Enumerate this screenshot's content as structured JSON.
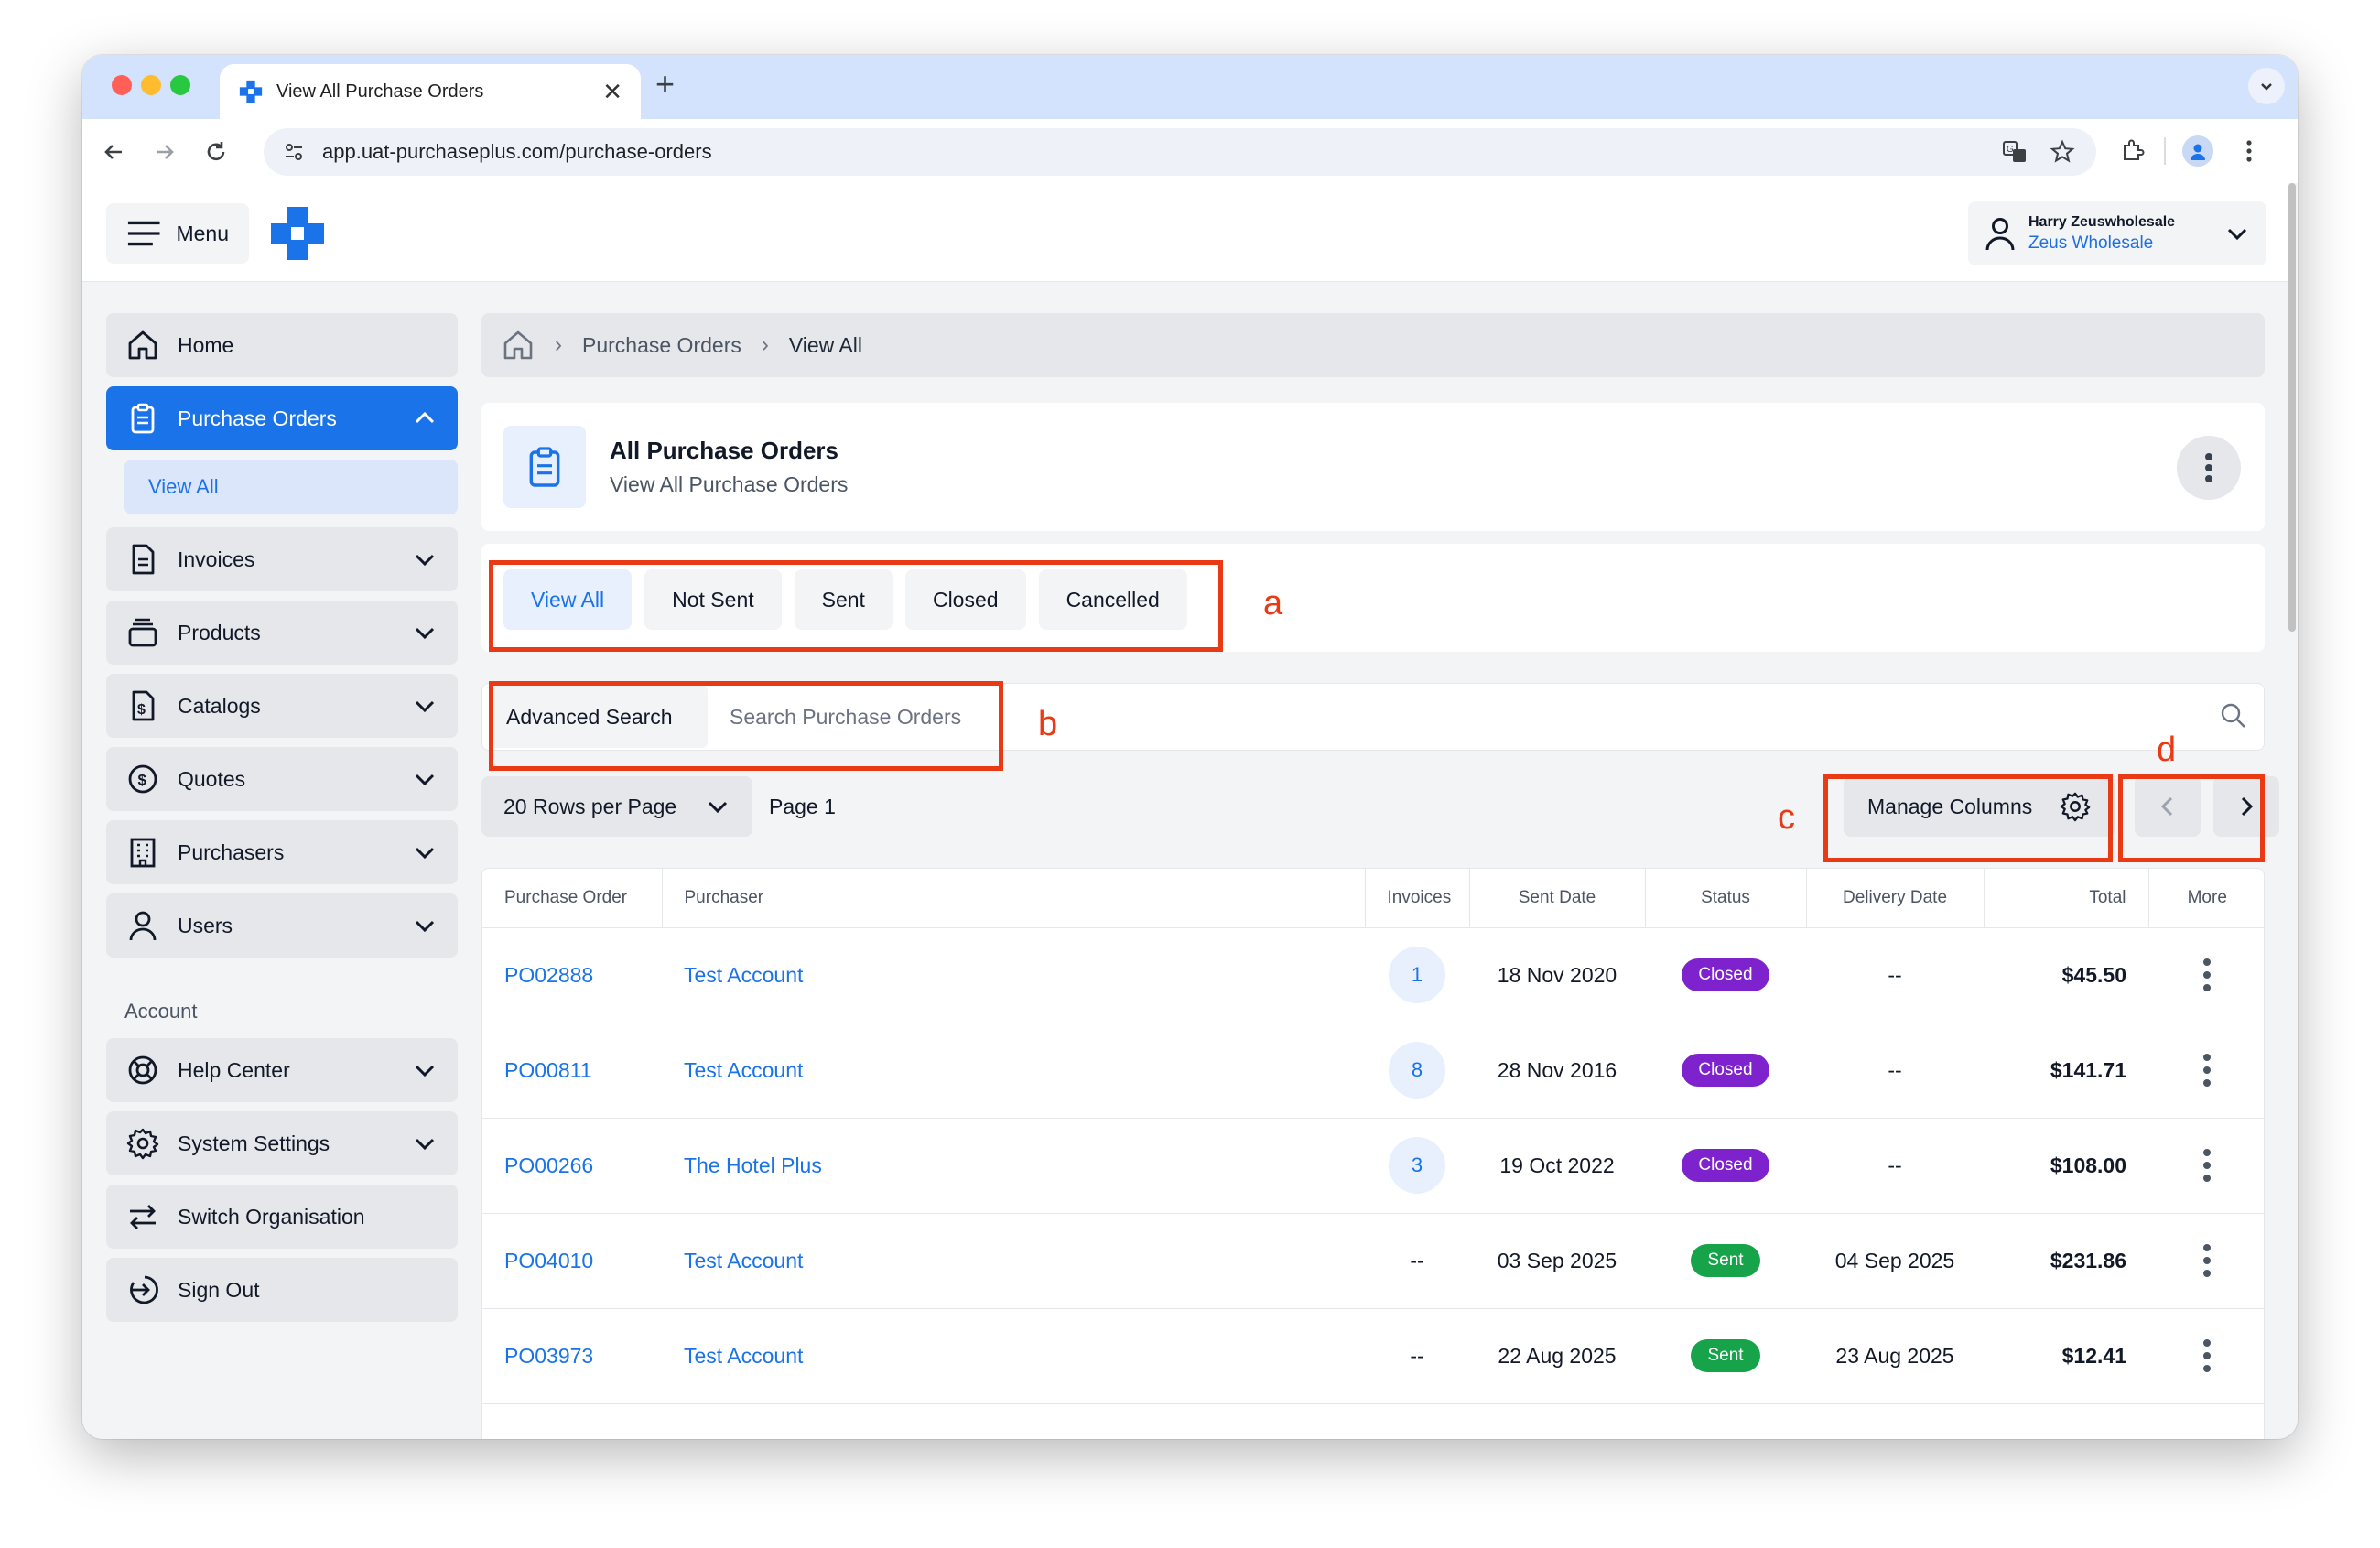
{
  "browser": {
    "tab_title": "View All Purchase Orders",
    "tab_close": "✕",
    "new_tab": "+",
    "url": "app.uat-purchaseplus.com/purchase-orders"
  },
  "topbar": {
    "menu_label": "Menu",
    "user_name": "Harry Zeuswholesale",
    "organisation": "Zeus Wholesale"
  },
  "sidebar": {
    "items": [
      {
        "label": "Home",
        "icon": "home-icon"
      },
      {
        "label": "Purchase Orders",
        "icon": "clipboard-icon",
        "active": true
      },
      {
        "label": "Invoices",
        "icon": "document-icon"
      },
      {
        "label": "Products",
        "icon": "box-stack-icon"
      },
      {
        "label": "Catalogs",
        "icon": "dollar-document-icon"
      },
      {
        "label": "Quotes",
        "icon": "dollar-circle-icon"
      },
      {
        "label": "Purchasers",
        "icon": "building-icon"
      },
      {
        "label": "Users",
        "icon": "user-icon"
      }
    ],
    "sub_item": "View All",
    "account_heading": "Account",
    "account_items": [
      {
        "label": "Help Center",
        "icon": "lifebuoy-icon"
      },
      {
        "label": "System Settings",
        "icon": "gear-icon"
      },
      {
        "label": "Switch Organisation",
        "icon": "swap-arrows-icon"
      },
      {
        "label": "Sign Out",
        "icon": "sign-out-icon"
      }
    ]
  },
  "breadcrumb": {
    "items": [
      "Purchase Orders",
      "View All"
    ]
  },
  "header": {
    "title": "All Purchase Orders",
    "subtitle": "View All Purchase Orders"
  },
  "filters": {
    "tabs": [
      "View All",
      "Not Sent",
      "Sent",
      "Closed",
      "Cancelled"
    ],
    "active": "View All"
  },
  "search": {
    "advanced_label": "Advanced Search",
    "placeholder": "Search Purchase Orders"
  },
  "controls": {
    "rows_per_page": "20 Rows per Page",
    "page_label": "Page 1",
    "manage_columns": "Manage Columns"
  },
  "table": {
    "columns": [
      "Purchase Order",
      "Purchaser",
      "Invoices",
      "Sent Date",
      "Status",
      "Delivery Date",
      "Total",
      "More"
    ],
    "rows": [
      {
        "po": "PO02888",
        "purchaser": "Test Account",
        "invoices": "1",
        "sent_date": "18 Nov 2020",
        "status": "Closed",
        "delivery_date": "--",
        "total": "$45.50"
      },
      {
        "po": "PO00811",
        "purchaser": "Test Account",
        "invoices": "8",
        "sent_date": "28 Nov 2016",
        "status": "Closed",
        "delivery_date": "--",
        "total": "$141.71"
      },
      {
        "po": "PO00266",
        "purchaser": "The Hotel Plus",
        "invoices": "3",
        "sent_date": "19 Oct 2022",
        "status": "Closed",
        "delivery_date": "--",
        "total": "$108.00"
      },
      {
        "po": "PO04010",
        "purchaser": "Test Account",
        "invoices": "--",
        "sent_date": "03 Sep 2025",
        "status": "Sent",
        "delivery_date": "04 Sep 2025",
        "total": "$231.86"
      },
      {
        "po": "PO03973",
        "purchaser": "Test Account",
        "invoices": "--",
        "sent_date": "22 Aug 2025",
        "status": "Sent",
        "delivery_date": "23 Aug 2025",
        "total": "$12.41"
      }
    ]
  },
  "annotations": {
    "a": "a",
    "b": "b",
    "c": "c",
    "d": "d"
  },
  "colors": {
    "accent": "#1a73e8",
    "closed": "#7e22ce",
    "sent": "#16a34a",
    "annotation": "#ea3a15"
  }
}
